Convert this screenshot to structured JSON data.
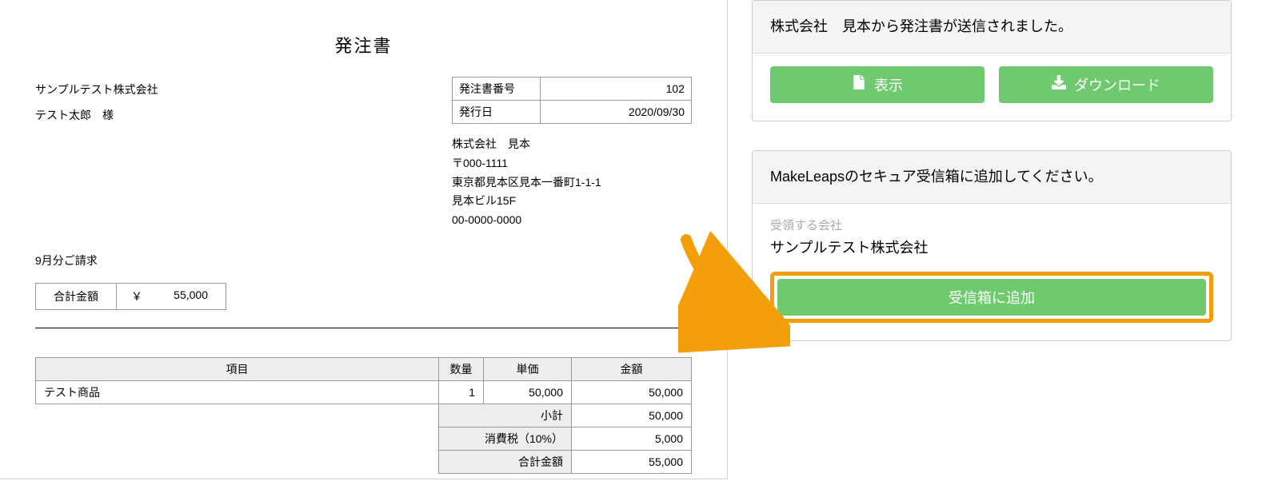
{
  "doc": {
    "title": "発注書",
    "addressee_company": "サンプルテスト株式会社",
    "addressee_person": "テスト太郎　様",
    "meta": {
      "po_number_label": "発注書番号",
      "po_number": "102",
      "issue_date_label": "発行日",
      "issue_date": "2020/09/30"
    },
    "sender": {
      "name": "株式会社　見本",
      "postal": "〒000-1111",
      "address": "東京都見本区見本一番町1-1-1",
      "building": "見本ビル15F",
      "phone": "00-0000-0000"
    },
    "billing_period": "9月分ご請求",
    "total_box": {
      "label": "合計金額",
      "currency": "￥",
      "value": "55,000"
    },
    "columns": {
      "item": "項目",
      "qty": "数量",
      "unit_price": "単価",
      "amount": "金額"
    },
    "items": [
      {
        "name": "テスト商品",
        "qty": "1",
        "unit_price": "50,000",
        "amount": "50,000"
      }
    ],
    "summary": {
      "subtotal_label": "小計",
      "subtotal": "50,000",
      "tax_label": "消費税（10%）",
      "tax": "5,000",
      "total_label": "合計金額",
      "total": "55,000"
    }
  },
  "side": {
    "notice": "株式会社　見本から発注書が送信されました。",
    "view_btn": "表示",
    "download_btn": "ダウンロード",
    "inbox_prompt": "MakeLeapsのセキュア受信箱に追加してください。",
    "receiving_company_label": "受領する会社",
    "receiving_company": "サンプルテスト株式会社",
    "add_inbox_btn": "受信箱に追加"
  }
}
